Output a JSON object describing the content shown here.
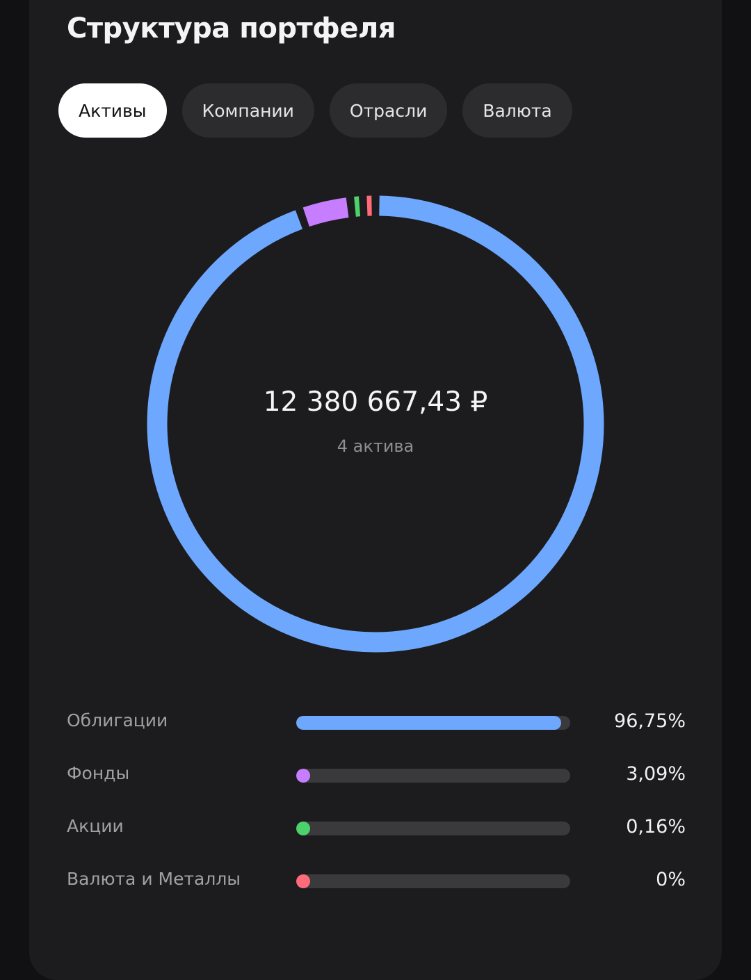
{
  "title": "Структура портфеля",
  "tabs": [
    {
      "label": "Активы",
      "active": true
    },
    {
      "label": "Компании",
      "active": false
    },
    {
      "label": "Отрасли",
      "active": false
    },
    {
      "label": "Валюта",
      "active": false
    }
  ],
  "summary": {
    "total": "12 380 667,43 ₽",
    "subtitle": "4 актива"
  },
  "chart_data": {
    "type": "pie",
    "categories": [
      "Облигации",
      "Фонды",
      "Акции",
      "Валюта и Металлы"
    ],
    "values": [
      96.75,
      3.09,
      0.16,
      0
    ],
    "colors": [
      "#6ea8fe",
      "#c77dff",
      "#4cd26b",
      "#ff6b7a"
    ],
    "value_labels": [
      "96,75%",
      "3,09%",
      "0,16%",
      "0%"
    ]
  }
}
